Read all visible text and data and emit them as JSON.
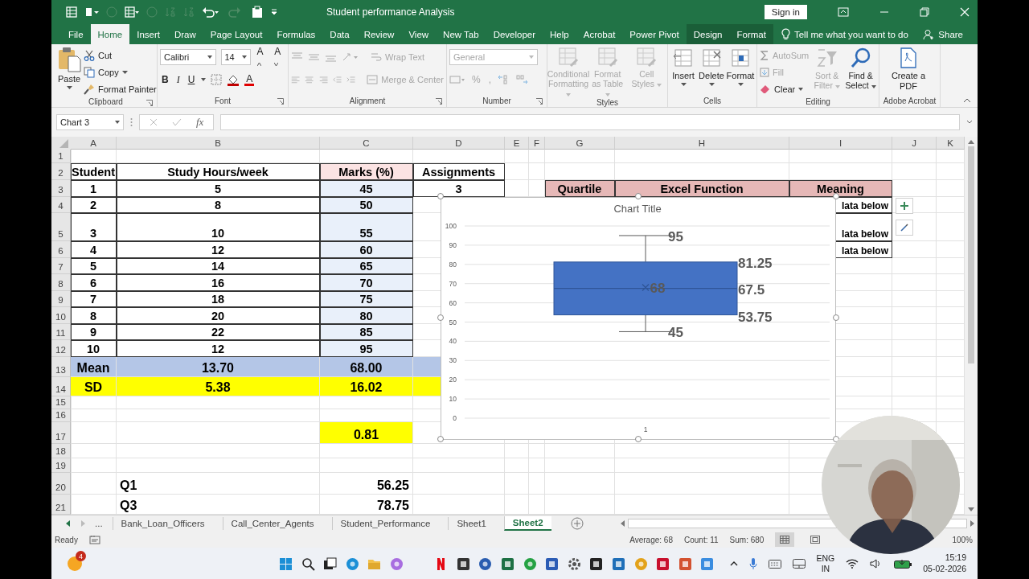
{
  "title_bar": {
    "title": "Student performance Analysis",
    "sign_in": "Sign in"
  },
  "menu_tabs": [
    {
      "label": "File",
      "selected": false,
      "contextual": false
    },
    {
      "label": "Home",
      "selected": true,
      "contextual": false
    },
    {
      "label": "Insert",
      "selected": false,
      "contextual": false
    },
    {
      "label": "Draw",
      "selected": false,
      "contextual": false
    },
    {
      "label": "Page Layout",
      "selected": false,
      "contextual": false
    },
    {
      "label": "Formulas",
      "selected": false,
      "contextual": false
    },
    {
      "label": "Data",
      "selected": false,
      "contextual": false
    },
    {
      "label": "Review",
      "selected": false,
      "contextual": false
    },
    {
      "label": "View",
      "selected": false,
      "contextual": false
    },
    {
      "label": "New Tab",
      "selected": false,
      "contextual": false
    },
    {
      "label": "Developer",
      "selected": false,
      "contextual": false
    },
    {
      "label": "Help",
      "selected": false,
      "contextual": false
    },
    {
      "label": "Acrobat",
      "selected": false,
      "contextual": false
    },
    {
      "label": "Power Pivot",
      "selected": false,
      "contextual": false
    },
    {
      "label": "Design",
      "selected": false,
      "contextual": true
    },
    {
      "label": "Format",
      "selected": false,
      "contextual": true
    }
  ],
  "tell_me": "Tell me what you want to do",
  "share": "Share",
  "ribbon": {
    "clipboard": {
      "label": "Clipboard",
      "paste": "Paste",
      "cut": "Cut",
      "copy": "Copy",
      "format_painter": "Format Painter",
      "disabled": false
    },
    "font": {
      "label": "Font",
      "name": "Calibri",
      "size": "14",
      "grow": "A",
      "shrink": "A",
      "bold": "B",
      "italic": "I",
      "underline": "U",
      "font_color": "A",
      "disabled": false
    },
    "alignment": {
      "label": "Alignment",
      "wrap_text": "Wrap Text",
      "merge_center": "Merge & Center",
      "disabled": true
    },
    "number": {
      "label": "Number",
      "format": "General",
      "percent": "%",
      "comma": ",",
      "disabled": true
    },
    "styles": {
      "label": "Styles",
      "buttons": [
        "Conditional Formatting",
        "Format as Table",
        "Cell Styles"
      ],
      "disabled": true
    },
    "cells": {
      "label": "Cells",
      "buttons": [
        "Insert",
        "Delete",
        "Format"
      ],
      "disabled": false
    },
    "editing": {
      "label": "Editing",
      "autosum": {
        "label": "AutoSum",
        "disabled": true
      },
      "fill": {
        "label": "Fill",
        "disabled": true
      },
      "clear": {
        "label": "Clear",
        "disabled": false
      },
      "sort_filter": {
        "label": "Sort & Filter",
        "disabled": true
      },
      "find_select": {
        "label": "Find & Select",
        "disabled": false
      }
    },
    "acrobat": {
      "label": "Adobe Acrobat",
      "create_pdf": "Create a PDF"
    }
  },
  "formula_bar": {
    "name_box": "Chart 3",
    "fx": "fx"
  },
  "columns": [
    "A",
    "B",
    "C",
    "D",
    "E",
    "F",
    "G",
    "H",
    "I",
    "J",
    "K"
  ],
  "rows": [
    {
      "header": "1",
      "cells": {}
    },
    {
      "header": "2",
      "kind": "plain",
      "cells": {
        "a": {
          "text": "Student",
          "boxed": true
        },
        "b": {
          "text": "Study Hours/week",
          "boxed": true
        },
        "c": {
          "text": "Marks (%)",
          "boxed": true,
          "color": "#fbe3e3"
        },
        "d": {
          "text": "Assignments",
          "boxed": true
        }
      }
    },
    {
      "header": "3",
      "kind": "plain",
      "cells": {
        "a": {
          "text": "1",
          "boxed": true
        },
        "b": {
          "text": "5",
          "boxed": true
        },
        "c": {
          "text": "45",
          "boxed": true,
          "color": "#e9f0fa"
        },
        "d": {
          "text": "3",
          "boxed": true
        },
        "g": {
          "text": "Quartile",
          "boxed": true,
          "color": "#e6b8b7"
        },
        "h": {
          "text": "Excel Function",
          "boxed": true,
          "color": "#e6b8b7"
        },
        "i": {
          "text": "Meaning",
          "boxed": true,
          "color": "#e6b8b7"
        }
      }
    },
    {
      "header": "4",
      "kind": "quartile",
      "cells": {
        "a": {
          "text": "2",
          "boxed": true
        },
        "b": {
          "text": "8",
          "boxed": true
        },
        "c": {
          "text": "50",
          "boxed": true,
          "color": "#e9f0fa"
        },
        "i": {
          "text": "lata below",
          "boxed": true
        }
      }
    },
    {
      "header": "5",
      "kind": "quartile",
      "cells": {
        "a": {
          "text": "3",
          "boxed": true
        },
        "b": {
          "text": "10",
          "boxed": true
        },
        "c": {
          "text": "55",
          "boxed": true,
          "color": "#e9f0fa"
        },
        "i": {
          "text": "lata below",
          "boxed": true
        }
      }
    },
    {
      "header": "6",
      "kind": "quartile",
      "cells": {
        "a": {
          "text": "4",
          "boxed": true
        },
        "b": {
          "text": "12",
          "boxed": true
        },
        "c": {
          "text": "60",
          "boxed": true,
          "color": "#e9f0fa"
        },
        "i": {
          "text": "lata below",
          "boxed": true
        }
      }
    },
    {
      "header": "7",
      "kind": "plain",
      "cells": {
        "a": {
          "text": "5",
          "boxed": true
        },
        "b": {
          "text": "14",
          "boxed": true
        },
        "c": {
          "text": "65",
          "boxed": true,
          "color": "#e9f0fa"
        }
      }
    },
    {
      "header": "8",
      "kind": "plain",
      "cells": {
        "a": {
          "text": "6",
          "boxed": true
        },
        "b": {
          "text": "16",
          "boxed": true
        },
        "c": {
          "text": "70",
          "boxed": true,
          "color": "#e9f0fa"
        }
      }
    },
    {
      "header": "9",
      "kind": "plain",
      "cells": {
        "a": {
          "text": "7",
          "boxed": true
        },
        "b": {
          "text": "18",
          "boxed": true
        },
        "c": {
          "text": "75",
          "boxed": true,
          "color": "#e9f0fa"
        }
      }
    },
    {
      "header": "10",
      "kind": "plain",
      "cells": {
        "a": {
          "text": "8",
          "boxed": true
        },
        "b": {
          "text": "20",
          "boxed": true
        },
        "c": {
          "text": "80",
          "boxed": true,
          "color": "#e9f0fa"
        }
      }
    },
    {
      "header": "11",
      "kind": "plain",
      "cells": {
        "a": {
          "text": "9",
          "boxed": true
        },
        "b": {
          "text": "22",
          "boxed": true
        },
        "c": {
          "text": "85",
          "boxed": true,
          "color": "#e9f0fa"
        }
      }
    },
    {
      "header": "12",
      "kind": "plain",
      "cells": {
        "a": {
          "text": "10",
          "boxed": true
        },
        "b": {
          "text": "12",
          "boxed": true
        },
        "c": {
          "text": "95",
          "boxed": true,
          "color": "#e9f0fa"
        }
      }
    },
    {
      "header": "13",
      "kind": "plain",
      "cells": {
        "a": {
          "text": "Mean",
          "boxed": false,
          "color": "#b4c6e7"
        },
        "b": {
          "text": "13.70",
          "boxed": false,
          "color": "#b4c6e7"
        },
        "c": {
          "text": "68.00",
          "boxed": false,
          "color": "#b4c6e7"
        },
        "d": {
          "boxed": false,
          "color": "#b4c6e7"
        }
      }
    },
    {
      "header": "14",
      "kind": "plain",
      "cells": {
        "a": {
          "text": "SD",
          "boxed": false,
          "color": "#ffff00"
        },
        "b": {
          "text": "5.38",
          "boxed": false,
          "color": "#ffff00"
        },
        "c": {
          "text": "16.02",
          "boxed": false,
          "color": "#ffff00"
        },
        "d": {
          "boxed": false,
          "color": "#ffff00"
        }
      }
    },
    {
      "header": "15",
      "cells": {}
    },
    {
      "header": "16",
      "cells": {}
    },
    {
      "header": "17",
      "kind": "plain",
      "cells": {
        "c": {
          "text": "0.81",
          "boxed": false,
          "color": "#ffff00"
        }
      }
    },
    {
      "header": "18",
      "cells": {}
    },
    {
      "header": "19",
      "cells": {}
    },
    {
      "header": "20",
      "kind": "result",
      "cells": {
        "b": {
          "text": "Q1",
          "boxed": false
        },
        "c": {
          "text": "56.25",
          "boxed": false
        }
      }
    },
    {
      "header": "21",
      "kind": "result",
      "cells": {
        "b": {
          "text": "Q3",
          "boxed": false
        },
        "c": {
          "text": "78.75",
          "boxed": false
        }
      }
    }
  ],
  "chart": {
    "chart_data": {
      "type": "box",
      "title": "Chart Title",
      "categories": [
        "1"
      ],
      "ylim": [
        0,
        100
      ],
      "yticks": [
        0,
        10,
        20,
        30,
        40,
        50,
        60,
        70,
        80,
        90,
        100
      ],
      "grid": true,
      "annotations": [
        "95",
        "81.25",
        "68",
        "67.5",
        "53.75",
        "45"
      ]
    }
  },
  "sheet_tabs": {
    "more": "...",
    "tabs": [
      {
        "label": "Bank_Loan_Officers",
        "selected": false
      },
      {
        "label": "Call_Center_Agents",
        "selected": false
      },
      {
        "label": "Student_Performance",
        "selected": false
      },
      {
        "label": "Sheet1",
        "selected": false
      },
      {
        "label": "Sheet2",
        "selected": true
      }
    ]
  },
  "status_bar": {
    "mode": "Ready",
    "average": "Average: 68",
    "count": "Count: 11",
    "sum": "Sum: 680",
    "zoom": "100%"
  },
  "taskbar": {
    "badge": "4",
    "language": "ENG",
    "region": "IN",
    "time": "15:19",
    "date": "05-02-2026"
  }
}
